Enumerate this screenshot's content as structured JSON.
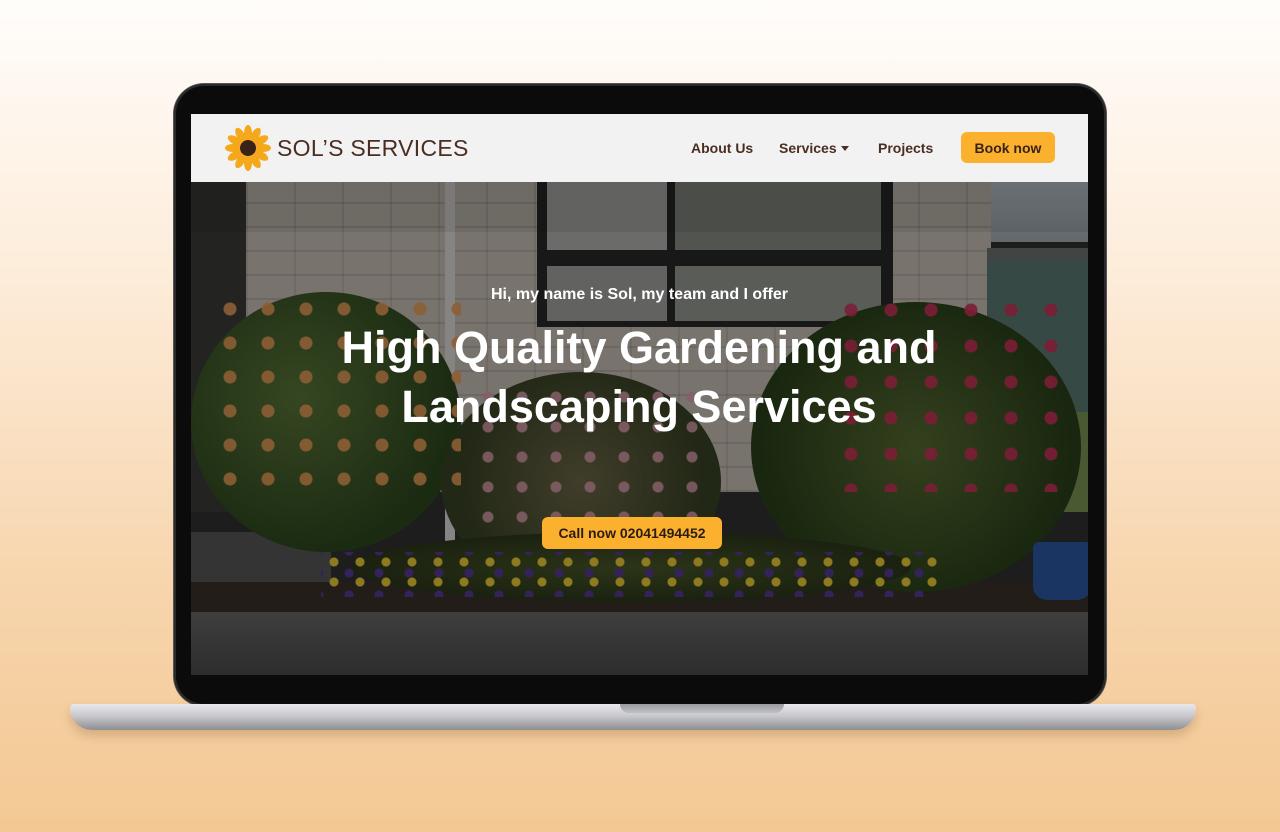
{
  "brand": {
    "name": "SOL’S SERVICES",
    "logo_icon": "sunflower-icon"
  },
  "nav": {
    "items": [
      {
        "label": "About Us"
      },
      {
        "label": "Services",
        "icon": "chevron-down-icon"
      },
      {
        "label": "Projects"
      }
    ],
    "cta_label": "Book now"
  },
  "hero": {
    "intro": "Hi, my name is Sol, my team and I offer",
    "headline": "High Quality Gardening and Landscaping Services",
    "cta_label": "Call now 02041494452"
  },
  "colors": {
    "accent": "#fbb02e",
    "brand_text": "#4a2e22",
    "nav_bg": "#f2f2f2"
  }
}
